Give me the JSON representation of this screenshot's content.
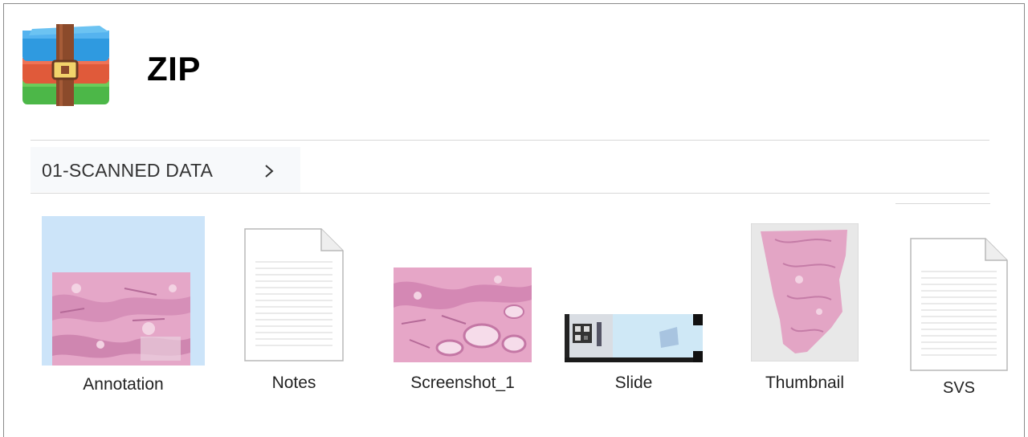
{
  "header": {
    "title": "ZIP",
    "app_icon": "archive-zip-icon"
  },
  "breadcrumb": {
    "label": "01-SCANNED DATA",
    "separator_icon": "chevron-right-icon"
  },
  "files": [
    {
      "name": "Annotation",
      "kind": "image-thumbnail",
      "selected": true
    },
    {
      "name": "Notes",
      "kind": "document"
    },
    {
      "name": "Screenshot_1",
      "kind": "image-thumbnail"
    },
    {
      "name": "Slide",
      "kind": "slide-label-image"
    },
    {
      "name": "Thumbnail",
      "kind": "image-thumbnail"
    },
    {
      "name": "SVS",
      "kind": "document"
    }
  ],
  "colors": {
    "selection": "#cce4f9",
    "tissue_pink": "#e5a7c8",
    "zip_blue": "#2f9ae0",
    "zip_red": "#e05a3a",
    "zip_green": "#4cb748",
    "zip_strap": "#8b4a2b"
  }
}
